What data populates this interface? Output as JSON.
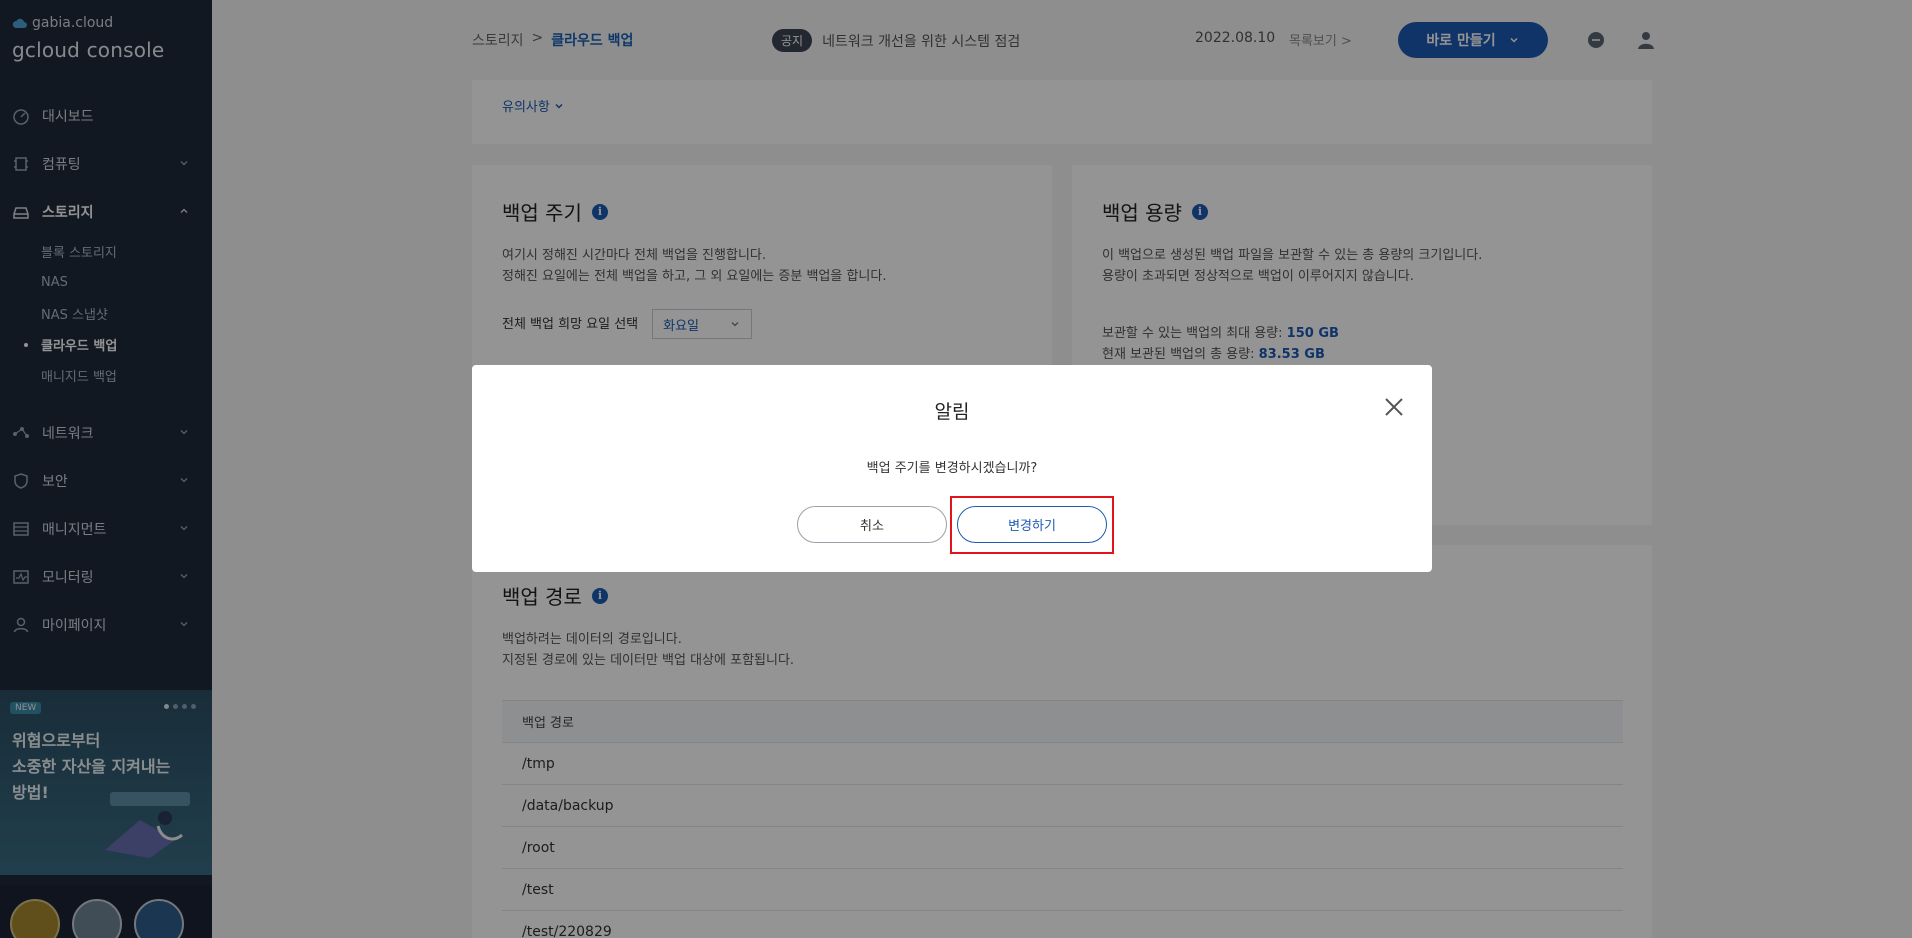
{
  "sidebar": {
    "logo_small": "gabia.cloud",
    "logo_big": "gcloud console",
    "items": [
      {
        "label": "대시보드",
        "icon": "dashboard-icon"
      },
      {
        "label": "컴퓨팅",
        "icon": "chip-icon"
      },
      {
        "label": "스토리지",
        "icon": "storage-icon"
      },
      {
        "label": "네트워크",
        "icon": "network-icon"
      },
      {
        "label": "보안",
        "icon": "shield-icon"
      },
      {
        "label": "매니지먼트",
        "icon": "management-icon"
      },
      {
        "label": "모니터링",
        "icon": "monitor-icon"
      },
      {
        "label": "마이페이지",
        "icon": "user-icon"
      }
    ],
    "storage_sub": [
      "블록 스토리지",
      "NAS",
      "NAS 스냅샷",
      "클라우드 백업",
      "매니지드 백업"
    ],
    "banner": {
      "badge": "NEW",
      "line1": "위협으로부터",
      "line2": "소중한 자산을 지켜내는",
      "line3": "방법!"
    }
  },
  "header": {
    "breadcrumb_parent": "스토리지",
    "breadcrumb_sep": ">",
    "breadcrumb_current": "클라우드 백업",
    "notice_badge": "공지",
    "notice_text": "네트워크 개선을 위한 시스템 점검",
    "notice_date": "2022.08.10",
    "notice_more": "목록보기 >",
    "create_button": "바로 만들기"
  },
  "content": {
    "caution_link": "유의사항",
    "cycle": {
      "title": "백업 주기",
      "desc1": "여기시 정해진 시간마다 전체 백업을 진행합니다.",
      "desc2": "정해진 요일에는 전체 백업을 하고, 그 외 요일에는 증분 백업을 합니다.",
      "day_label": "전체 백업 희망 요일 선택",
      "day_value": "화요일"
    },
    "capacity": {
      "title": "백업 용량",
      "desc1": "이 백업으로 생성된 백업 파일을 보관할 수 있는 총 용량의 크기입니다.",
      "desc2": "용량이 초과되면 정상적으로 백업이 이루어지지 않습니다.",
      "max_label": "보관할 수 있는 백업의 최대 용량:",
      "max_value": "150 GB",
      "used_label": "현재 보관된 백업의 총 용량:",
      "used_value": "83.53 GB"
    },
    "path": {
      "title": "백업 경로",
      "desc1": "백업하려는 데이터의 경로입니다.",
      "desc2": "지정된 경로에 있는 데이터만 백업 대상에 포함됩니다.",
      "column": "백업 경로",
      "rows": [
        "/tmp",
        "/data/backup",
        "/root",
        "/test",
        "/test/220829"
      ]
    }
  },
  "modal": {
    "title": "알림",
    "message": "백업 주기를 변경하시겠습니까?",
    "cancel": "취소",
    "confirm": "변경하기"
  }
}
